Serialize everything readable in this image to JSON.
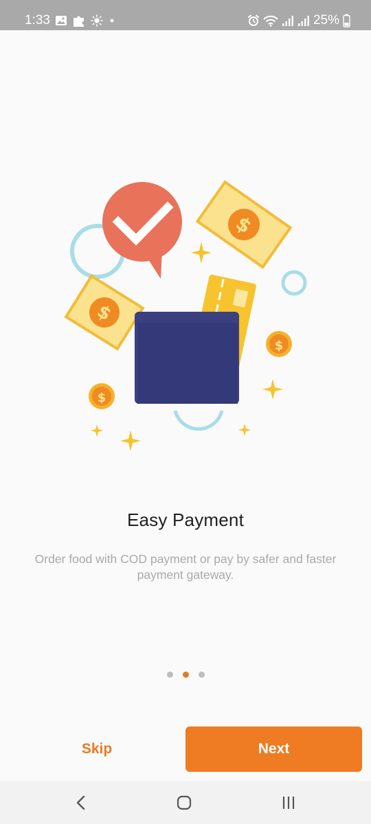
{
  "status_bar": {
    "time": "1:33",
    "battery_percent": "25%",
    "left_icons": [
      "gallery-icon",
      "puzzle-icon",
      "brightness-icon",
      "dot-icon"
    ],
    "right_icons": [
      "alarm-icon",
      "wifi-icon",
      "signal-icon",
      "signal-icon",
      "battery-icon"
    ]
  },
  "onboarding": {
    "illustration": "wallet-payment-illustration",
    "title": "Easy Payment",
    "description": "Order food with COD payment or pay by safer and faster payment gateway.",
    "page_index": 2,
    "page_count": 3
  },
  "actions": {
    "skip_label": "Skip",
    "next_label": "Next"
  },
  "navigation_bar": {
    "buttons": [
      "back-icon",
      "home-icon",
      "recent-apps-icon"
    ]
  },
  "colors": {
    "accent": "#ef7b22",
    "status_bar": "#a9a9a9",
    "background": "#fafafa",
    "wallet": "#3b4080",
    "bubble": "#e8735a",
    "coin": "#ef8b22",
    "bill": "#fbe28f",
    "ring": "#a7dde7",
    "card": "#f7c32e"
  }
}
